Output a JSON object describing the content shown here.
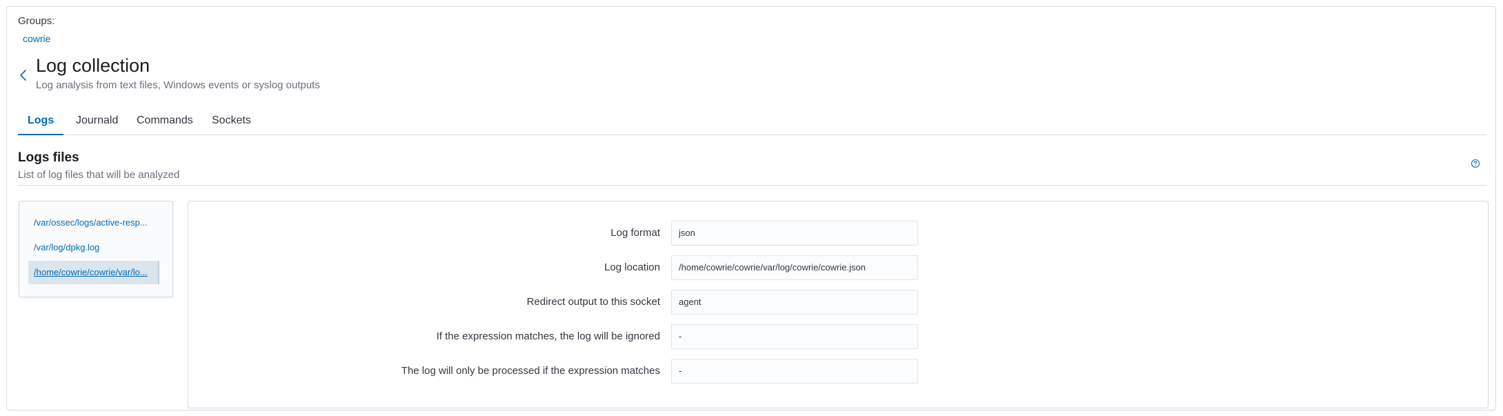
{
  "groups": {
    "label": "Groups:",
    "items": [
      "cowrie"
    ]
  },
  "header": {
    "title": "Log collection",
    "subtitle": "Log analysis from text files, Windows events or syslog outputs"
  },
  "tabs": [
    {
      "label": "Logs",
      "active": true
    },
    {
      "label": "Journald",
      "active": false
    },
    {
      "label": "Commands",
      "active": false
    },
    {
      "label": "Sockets",
      "active": false
    }
  ],
  "section": {
    "title": "Logs files",
    "subtitle": "List of log files that will be analyzed",
    "help_icon": "question-circle-icon"
  },
  "files": [
    {
      "label": "/var/ossec/logs/active-resp...",
      "selected": false
    },
    {
      "label": "/var/log/dpkg.log",
      "selected": false
    },
    {
      "label": "/home/cowrie/cowrie/var/lo...",
      "selected": true
    }
  ],
  "details": [
    {
      "label": "Log format",
      "value": "json"
    },
    {
      "label": "Log location",
      "value": "/home/cowrie/cowrie/var/log/cowrie/cowrie.json"
    },
    {
      "label": "Redirect output to this socket",
      "value": "agent"
    },
    {
      "label": "If the expression matches, the log will be ignored",
      "value": "-"
    },
    {
      "label": "The log will only be processed if the expression matches",
      "value": "-"
    }
  ],
  "colors": {
    "accent": "#006bb4",
    "border": "#d3dae6",
    "selected_bg": "#dbe5ee"
  }
}
